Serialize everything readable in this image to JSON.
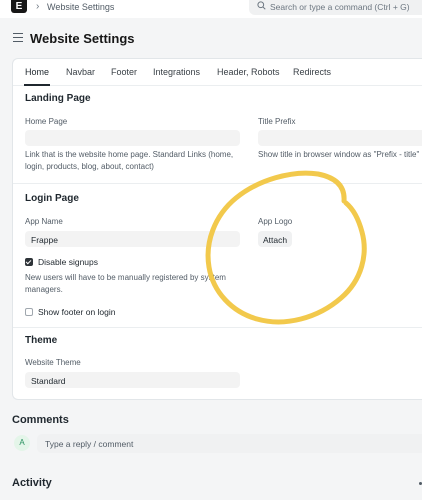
{
  "navbar": {
    "logo_letter": "E",
    "breadcrumb_separator": "›",
    "breadcrumb": "Website Settings",
    "search_placeholder": "Search or type a command (Ctrl + G)"
  },
  "page": {
    "title": "Website Settings"
  },
  "tabs": [
    {
      "label": "Home",
      "active": true
    },
    {
      "label": "Navbar"
    },
    {
      "label": "Footer"
    },
    {
      "label": "Integrations"
    },
    {
      "label": "Header, Robots"
    },
    {
      "label": "Redirects"
    }
  ],
  "landing": {
    "title": "Landing Page",
    "home_page_label": "Home Page",
    "home_page_value": "",
    "home_page_desc_1": "Link that is the website home page. Standard Links (home,",
    "home_page_desc_2": "login, products, blog, about, contact)",
    "title_prefix_label": "Title Prefix",
    "title_prefix_value": "",
    "title_prefix_desc": "Show title in browser window as \"Prefix - title\""
  },
  "login": {
    "title": "Login Page",
    "app_name_label": "App Name",
    "app_name_value": "Frappe",
    "app_logo_label": "App Logo",
    "attach_label": "Attach",
    "disable_signups_label": "Disable signups",
    "disable_signups_checked": true,
    "disable_signups_desc_1": "New users will have to be manually registered by system",
    "disable_signups_desc_2": "managers.",
    "show_footer_label": "Show footer on login",
    "show_footer_checked": false
  },
  "theme": {
    "title": "Theme",
    "website_theme_label": "Website Theme",
    "website_theme_value": "Standard"
  },
  "comments": {
    "title": "Comments",
    "avatar_initial": "A",
    "placeholder": "Type a reply / comment"
  },
  "activity": {
    "title": "Activity"
  },
  "icons": {
    "search": "search-icon",
    "menu": "hamburger-icon",
    "annotation": "yellow-hand-drawn-circle"
  },
  "colors": {
    "annotation": "#f2c94c",
    "text": "#1f272e",
    "muted": "#525c66",
    "input_bg": "#f3f3f3"
  }
}
